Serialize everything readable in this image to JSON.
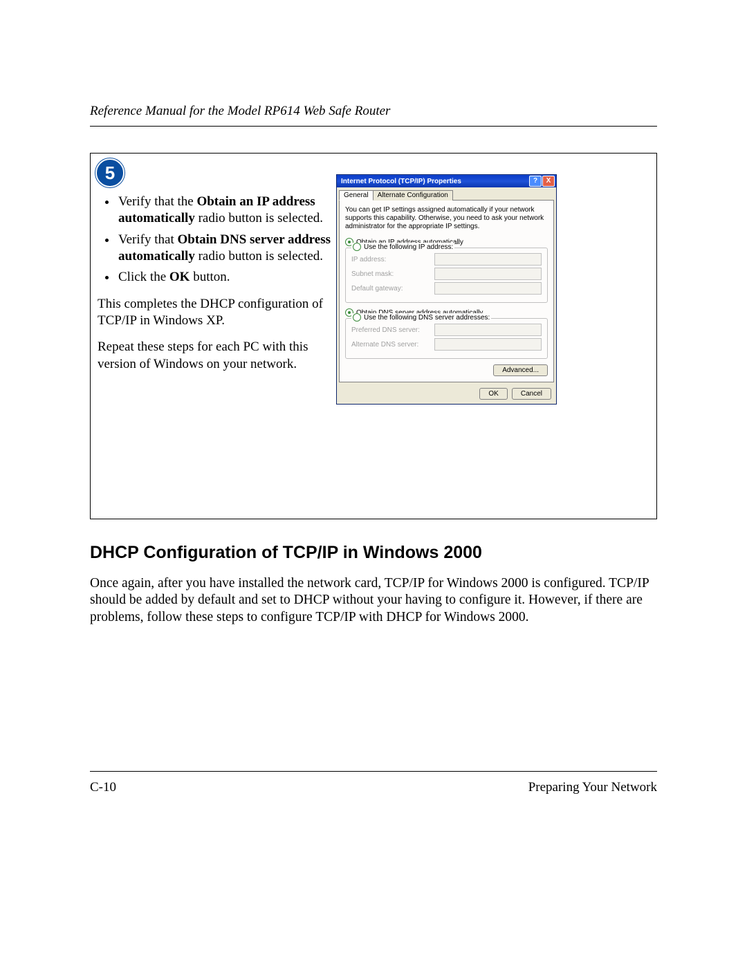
{
  "header": {
    "running_title": "Reference Manual for the Model RP614 Web Safe Router"
  },
  "figure": {
    "step_number": "5",
    "bullets": {
      "b1_pre": "Verify that the ",
      "b1_bold": "Obtain an IP address automatically",
      "b1_post": " radio button is selected.",
      "b2_pre": "Verify that ",
      "b2_bold": "Obtain DNS server address automatically",
      "b2_post": " radio button is selected.",
      "b3_pre": "Click the ",
      "b3_bold": "OK",
      "b3_post": " button."
    },
    "para1": "This completes the DHCP configuration of TCP/IP in Windows XP.",
    "para2": "Repeat these steps for each PC with this version of Windows on your network."
  },
  "dialog": {
    "title": "Internet Protocol (TCP/IP) Properties",
    "help_glyph": "?",
    "close_glyph": "X",
    "tabs": {
      "general": "General",
      "alt": "Alternate Configuration"
    },
    "description": "You can get IP settings assigned automatically if your network supports this capability. Otherwise, you need to ask your network administrator for the appropriate IP settings.",
    "radio_ip_auto": "Obtain an IP address automatically",
    "radio_ip_manual": "Use the following IP address:",
    "labels": {
      "ip": "IP address:",
      "mask": "Subnet mask:",
      "gw": "Default gateway:",
      "pdns": "Preferred DNS server:",
      "adns": "Alternate DNS server:"
    },
    "radio_dns_auto": "Obtain DNS server address automatically",
    "radio_dns_manual": "Use the following DNS server addresses:",
    "buttons": {
      "advanced": "Advanced...",
      "ok": "OK",
      "cancel": "Cancel"
    }
  },
  "section": {
    "heading": "DHCP Configuration of TCP/IP in Windows 2000",
    "para": "Once again, after you have installed the network card, TCP/IP for Windows 2000 is configured. TCP/IP should be added by default and set to DHCP without your having to configure it. However, if there are problems, follow these steps to configure TCP/IP with DHCP for Windows 2000."
  },
  "footer": {
    "page": "C-10",
    "chapter": "Preparing Your Network"
  }
}
